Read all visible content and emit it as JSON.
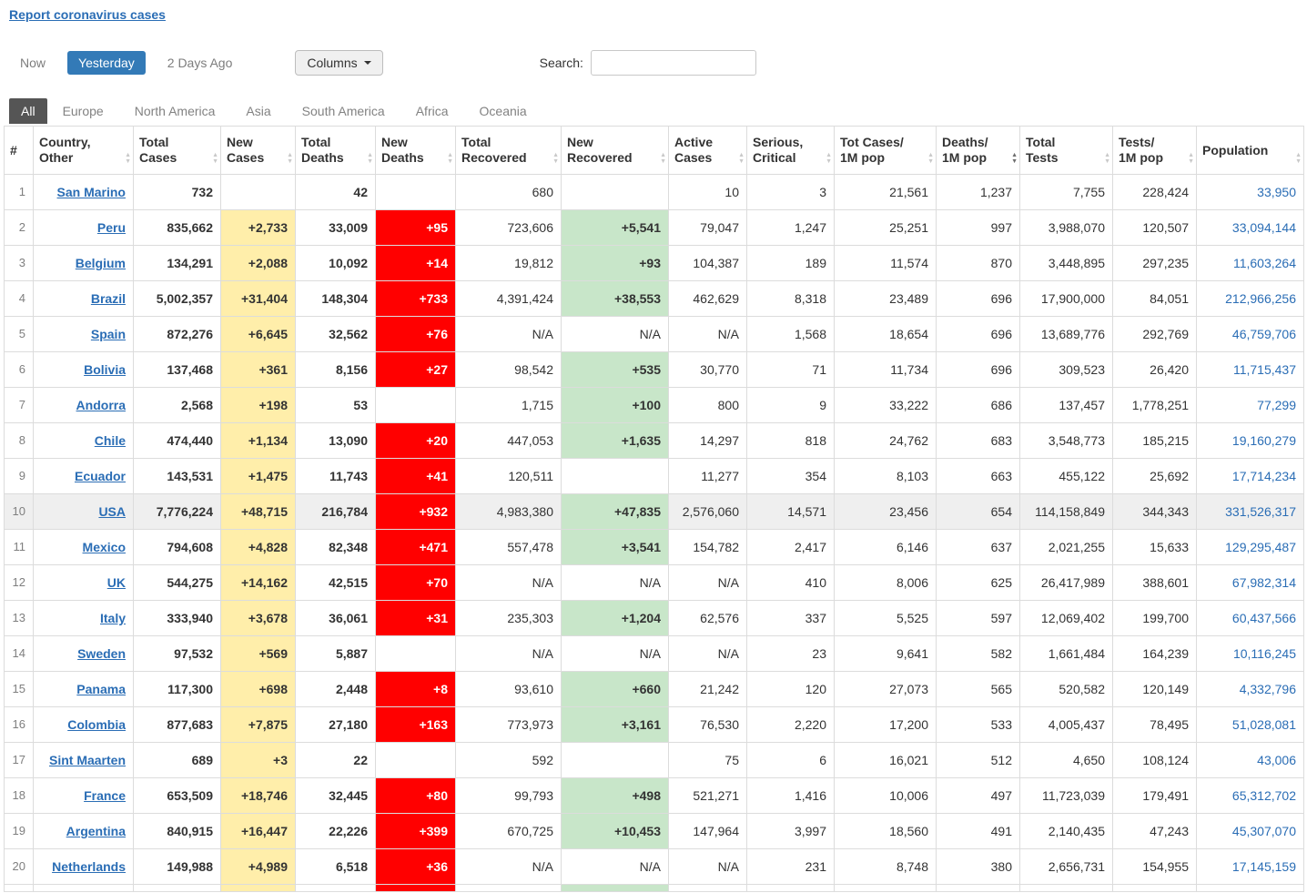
{
  "page": {
    "report_link": "Report coronavirus cases"
  },
  "toolbar": {
    "time_tabs": [
      {
        "label": "Now",
        "active": false
      },
      {
        "label": "Yesterday",
        "active": true
      },
      {
        "label": "2 Days Ago",
        "active": false
      }
    ],
    "columns_button": "Columns",
    "search_label": "Search:",
    "search_value": ""
  },
  "continent_tabs": [
    {
      "label": "All",
      "active": true
    },
    {
      "label": "Europe",
      "active": false
    },
    {
      "label": "North America",
      "active": false
    },
    {
      "label": "Asia",
      "active": false
    },
    {
      "label": "South America",
      "active": false
    },
    {
      "label": "Africa",
      "active": false
    },
    {
      "label": "Oceania",
      "active": false
    }
  ],
  "colors": {
    "accent_blue": "#337ab7",
    "link_blue": "#2a6db5",
    "new_cases_bg": "#FFEEAA",
    "new_deaths_bg": "#FF0000",
    "new_recovered_bg": "#C8E6C9",
    "active_continent_tab_bg": "#555555"
  },
  "table": {
    "columns": [
      {
        "key": "rank",
        "label": "#"
      },
      {
        "key": "country",
        "label": "Country,\nOther"
      },
      {
        "key": "total_cases",
        "label": "Total\nCases"
      },
      {
        "key": "new_cases",
        "label": "New\nCases"
      },
      {
        "key": "total_deaths",
        "label": "Total\nDeaths"
      },
      {
        "key": "new_deaths",
        "label": "New\nDeaths"
      },
      {
        "key": "total_recovered",
        "label": "Total\nRecovered"
      },
      {
        "key": "new_recovered",
        "label": "New\nRecovered"
      },
      {
        "key": "active_cases",
        "label": "Active\nCases"
      },
      {
        "key": "serious_critical",
        "label": "Serious,\nCritical"
      },
      {
        "key": "cases_per_1m",
        "label": "Tot Cases/\n1M pop"
      },
      {
        "key": "deaths_per_1m",
        "label": "Deaths/\n1M pop",
        "sorted": "desc"
      },
      {
        "key": "total_tests",
        "label": "Total\nTests"
      },
      {
        "key": "tests_per_1m",
        "label": "Tests/\n1M pop"
      },
      {
        "key": "population",
        "label": "Population"
      }
    ],
    "rows": [
      {
        "rank": "1",
        "country": "San Marino",
        "total_cases": "732",
        "new_cases": "",
        "total_deaths": "42",
        "new_deaths": "",
        "total_recovered": "680",
        "new_recovered": "",
        "active_cases": "10",
        "serious_critical": "3",
        "cases_per_1m": "21,561",
        "deaths_per_1m": "1,237",
        "total_tests": "7,755",
        "tests_per_1m": "228,424",
        "population": "33,950"
      },
      {
        "rank": "2",
        "country": "Peru",
        "total_cases": "835,662",
        "new_cases": "+2,733",
        "total_deaths": "33,009",
        "new_deaths": "+95",
        "total_recovered": "723,606",
        "new_recovered": "+5,541",
        "active_cases": "79,047",
        "serious_critical": "1,247",
        "cases_per_1m": "25,251",
        "deaths_per_1m": "997",
        "total_tests": "3,988,070",
        "tests_per_1m": "120,507",
        "population": "33,094,144"
      },
      {
        "rank": "3",
        "country": "Belgium",
        "total_cases": "134,291",
        "new_cases": "+2,088",
        "total_deaths": "10,092",
        "new_deaths": "+14",
        "total_recovered": "19,812",
        "new_recovered": "+93",
        "active_cases": "104,387",
        "serious_critical": "189",
        "cases_per_1m": "11,574",
        "deaths_per_1m": "870",
        "total_tests": "3,448,895",
        "tests_per_1m": "297,235",
        "population": "11,603,264"
      },
      {
        "rank": "4",
        "country": "Brazil",
        "total_cases": "5,002,357",
        "new_cases": "+31,404",
        "total_deaths": "148,304",
        "new_deaths": "+733",
        "total_recovered": "4,391,424",
        "new_recovered": "+38,553",
        "active_cases": "462,629",
        "serious_critical": "8,318",
        "cases_per_1m": "23,489",
        "deaths_per_1m": "696",
        "total_tests": "17,900,000",
        "tests_per_1m": "84,051",
        "population": "212,966,256"
      },
      {
        "rank": "5",
        "country": "Spain",
        "total_cases": "872,276",
        "new_cases": "+6,645",
        "total_deaths": "32,562",
        "new_deaths": "+76",
        "total_recovered": "N/A",
        "new_recovered": "N/A",
        "active_cases": "N/A",
        "serious_critical": "1,568",
        "cases_per_1m": "18,654",
        "deaths_per_1m": "696",
        "total_tests": "13,689,776",
        "tests_per_1m": "292,769",
        "population": "46,759,706"
      },
      {
        "rank": "6",
        "country": "Bolivia",
        "total_cases": "137,468",
        "new_cases": "+361",
        "total_deaths": "8,156",
        "new_deaths": "+27",
        "total_recovered": "98,542",
        "new_recovered": "+535",
        "active_cases": "30,770",
        "serious_critical": "71",
        "cases_per_1m": "11,734",
        "deaths_per_1m": "696",
        "total_tests": "309,523",
        "tests_per_1m": "26,420",
        "population": "11,715,437"
      },
      {
        "rank": "7",
        "country": "Andorra",
        "total_cases": "2,568",
        "new_cases": "+198",
        "total_deaths": "53",
        "new_deaths": "",
        "total_recovered": "1,715",
        "new_recovered": "+100",
        "active_cases": "800",
        "serious_critical": "9",
        "cases_per_1m": "33,222",
        "deaths_per_1m": "686",
        "total_tests": "137,457",
        "tests_per_1m": "1,778,251",
        "population": "77,299"
      },
      {
        "rank": "8",
        "country": "Chile",
        "total_cases": "474,440",
        "new_cases": "+1,134",
        "total_deaths": "13,090",
        "new_deaths": "+20",
        "total_recovered": "447,053",
        "new_recovered": "+1,635",
        "active_cases": "14,297",
        "serious_critical": "818",
        "cases_per_1m": "24,762",
        "deaths_per_1m": "683",
        "total_tests": "3,548,773",
        "tests_per_1m": "185,215",
        "population": "19,160,279"
      },
      {
        "rank": "9",
        "country": "Ecuador",
        "total_cases": "143,531",
        "new_cases": "+1,475",
        "total_deaths": "11,743",
        "new_deaths": "+41",
        "total_recovered": "120,511",
        "new_recovered": "",
        "active_cases": "11,277",
        "serious_critical": "354",
        "cases_per_1m": "8,103",
        "deaths_per_1m": "663",
        "total_tests": "455,122",
        "tests_per_1m": "25,692",
        "population": "17,714,234"
      },
      {
        "rank": "10",
        "country": "USA",
        "highlight": true,
        "total_cases": "7,776,224",
        "new_cases": "+48,715",
        "total_deaths": "216,784",
        "new_deaths": "+932",
        "total_recovered": "4,983,380",
        "new_recovered": "+47,835",
        "active_cases": "2,576,060",
        "serious_critical": "14,571",
        "cases_per_1m": "23,456",
        "deaths_per_1m": "654",
        "total_tests": "114,158,849",
        "tests_per_1m": "344,343",
        "population": "331,526,317"
      },
      {
        "rank": "11",
        "country": "Mexico",
        "total_cases": "794,608",
        "new_cases": "+4,828",
        "total_deaths": "82,348",
        "new_deaths": "+471",
        "total_recovered": "557,478",
        "new_recovered": "+3,541",
        "active_cases": "154,782",
        "serious_critical": "2,417",
        "cases_per_1m": "6,146",
        "deaths_per_1m": "637",
        "total_tests": "2,021,255",
        "tests_per_1m": "15,633",
        "population": "129,295,487"
      },
      {
        "rank": "12",
        "country": "UK",
        "total_cases": "544,275",
        "new_cases": "+14,162",
        "total_deaths": "42,515",
        "new_deaths": "+70",
        "total_recovered": "N/A",
        "new_recovered": "N/A",
        "active_cases": "N/A",
        "serious_critical": "410",
        "cases_per_1m": "8,006",
        "deaths_per_1m": "625",
        "total_tests": "26,417,989",
        "tests_per_1m": "388,601",
        "population": "67,982,314"
      },
      {
        "rank": "13",
        "country": "Italy",
        "total_cases": "333,940",
        "new_cases": "+3,678",
        "total_deaths": "36,061",
        "new_deaths": "+31",
        "total_recovered": "235,303",
        "new_recovered": "+1,204",
        "active_cases": "62,576",
        "serious_critical": "337",
        "cases_per_1m": "5,525",
        "deaths_per_1m": "597",
        "total_tests": "12,069,402",
        "tests_per_1m": "199,700",
        "population": "60,437,566"
      },
      {
        "rank": "14",
        "country": "Sweden",
        "total_cases": "97,532",
        "new_cases": "+569",
        "total_deaths": "5,887",
        "new_deaths": "",
        "total_recovered": "N/A",
        "new_recovered": "N/A",
        "active_cases": "N/A",
        "serious_critical": "23",
        "cases_per_1m": "9,641",
        "deaths_per_1m": "582",
        "total_tests": "1,661,484",
        "tests_per_1m": "164,239",
        "population": "10,116,245"
      },
      {
        "rank": "15",
        "country": "Panama",
        "total_cases": "117,300",
        "new_cases": "+698",
        "total_deaths": "2,448",
        "new_deaths": "+8",
        "total_recovered": "93,610",
        "new_recovered": "+660",
        "active_cases": "21,242",
        "serious_critical": "120",
        "cases_per_1m": "27,073",
        "deaths_per_1m": "565",
        "total_tests": "520,582",
        "tests_per_1m": "120,149",
        "population": "4,332,796"
      },
      {
        "rank": "16",
        "country": "Colombia",
        "total_cases": "877,683",
        "new_cases": "+7,875",
        "total_deaths": "27,180",
        "new_deaths": "+163",
        "total_recovered": "773,973",
        "new_recovered": "+3,161",
        "active_cases": "76,530",
        "serious_critical": "2,220",
        "cases_per_1m": "17,200",
        "deaths_per_1m": "533",
        "total_tests": "4,005,437",
        "tests_per_1m": "78,495",
        "population": "51,028,081"
      },
      {
        "rank": "17",
        "country": "Sint Maarten",
        "total_cases": "689",
        "new_cases": "+3",
        "total_deaths": "22",
        "new_deaths": "",
        "total_recovered": "592",
        "new_recovered": "",
        "active_cases": "75",
        "serious_critical": "6",
        "cases_per_1m": "16,021",
        "deaths_per_1m": "512",
        "total_tests": "4,650",
        "tests_per_1m": "108,124",
        "population": "43,006"
      },
      {
        "rank": "18",
        "country": "France",
        "total_cases": "653,509",
        "new_cases": "+18,746",
        "total_deaths": "32,445",
        "new_deaths": "+80",
        "total_recovered": "99,793",
        "new_recovered": "+498",
        "active_cases": "521,271",
        "serious_critical": "1,416",
        "cases_per_1m": "10,006",
        "deaths_per_1m": "497",
        "total_tests": "11,723,039",
        "tests_per_1m": "179,491",
        "population": "65,312,702"
      },
      {
        "rank": "19",
        "country": "Argentina",
        "total_cases": "840,915",
        "new_cases": "+16,447",
        "total_deaths": "22,226",
        "new_deaths": "+399",
        "total_recovered": "670,725",
        "new_recovered": "+10,453",
        "active_cases": "147,964",
        "serious_critical": "3,997",
        "cases_per_1m": "18,560",
        "deaths_per_1m": "491",
        "total_tests": "2,140,435",
        "tests_per_1m": "47,243",
        "population": "45,307,070"
      },
      {
        "rank": "20",
        "country": "Netherlands",
        "total_cases": "149,988",
        "new_cases": "+4,989",
        "total_deaths": "6,518",
        "new_deaths": "+36",
        "total_recovered": "N/A",
        "new_recovered": "N/A",
        "active_cases": "N/A",
        "serious_critical": "231",
        "cases_per_1m": "8,748",
        "deaths_per_1m": "380",
        "total_tests": "2,656,731",
        "tests_per_1m": "154,955",
        "population": "17,145,159"
      }
    ],
    "partial_next_row": true
  }
}
